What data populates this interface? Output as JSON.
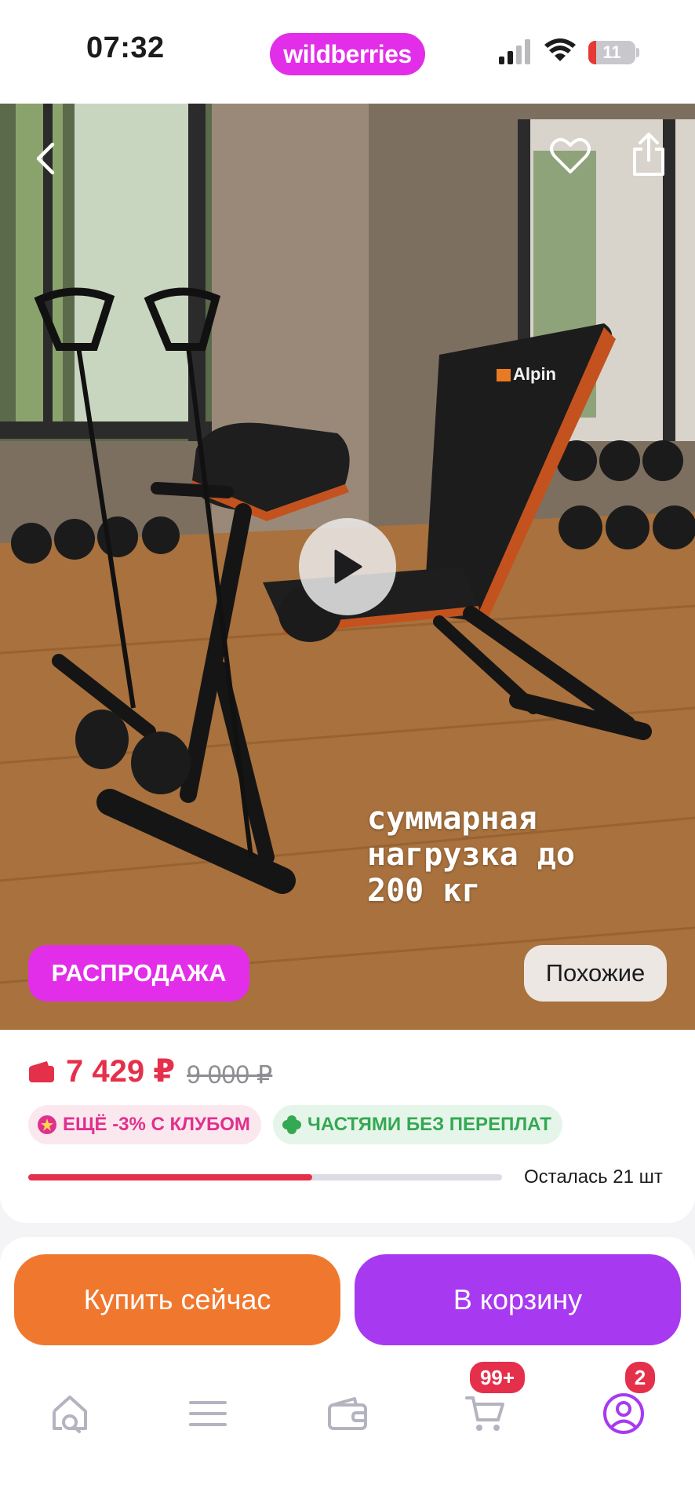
{
  "status_bar": {
    "time": "07:32",
    "brand": "wildberries",
    "battery": "11"
  },
  "hero": {
    "overlay_text": "суммарная\nнагрузка до\n200 кг",
    "product_logo": "Alpin",
    "sale_badge": "РАСПРОДАЖА",
    "similar_button": "Похожие"
  },
  "price": {
    "current": "7 429 ₽",
    "old": "9 000 ₽",
    "club_chip": "ЕЩЁ -3% С КЛУБОМ",
    "installments_chip": "ЧАСТЯМИ БЕЗ ПЕРЕПЛАТ",
    "stock_text": "Осталась 21 шт",
    "stock_progress": 0.6
  },
  "actions": {
    "buy_now": "Купить сейчас",
    "add_to_cart": "В корзину"
  },
  "tabbar": {
    "items": [
      "home-search",
      "catalog",
      "wallet",
      "cart",
      "profile"
    ],
    "cart_badge": "99+",
    "profile_badge": "2"
  },
  "colors": {
    "brand": "#e22ee8",
    "price": "#e5304b",
    "buy_now": "#f0782e",
    "to_cart": "#a73af0",
    "installments": "#34a853"
  }
}
